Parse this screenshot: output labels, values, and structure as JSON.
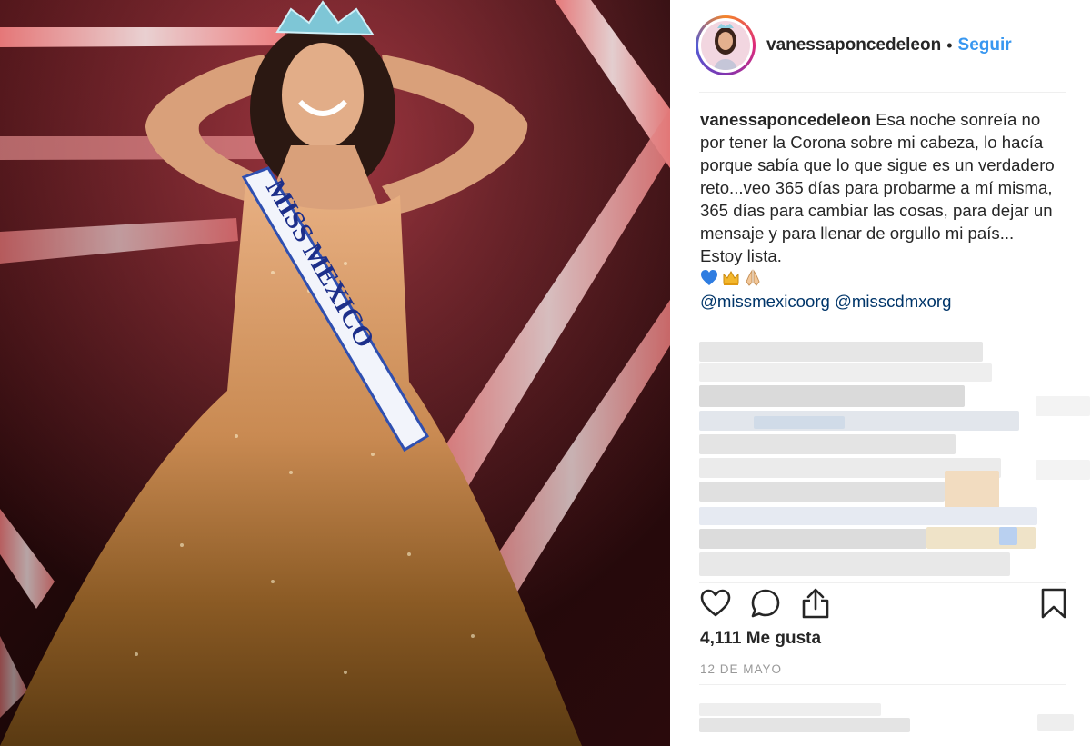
{
  "post": {
    "image_description_icon": "photo",
    "sash_text": "MISS MEXICO"
  },
  "header": {
    "username": "vanessaponcedeleon",
    "separator": "•",
    "follow_label": "Seguir"
  },
  "caption": {
    "username": "vanessaponcedeleon",
    "text": "Esa noche sonreía no por tener la Corona sobre mi cabeza, lo hacía porque sabía que lo que sigue es un verdadero reto...veo 365 días para probarme a mí misma, 365 días para cambiar las cosas, para dejar un mensaje y para llenar de orgullo mi país...",
    "closing": "Estoy lista.",
    "emojis": [
      "blue-heart-icon",
      "crown-icon",
      "praying-hands-icon"
    ],
    "mentions": [
      "@missmexicoorg",
      "@misscdmxorg"
    ]
  },
  "actions": {
    "icons": [
      "heart-icon",
      "comment-icon",
      "share-icon",
      "bookmark-icon"
    ]
  },
  "likes": {
    "label": "4,111 Me gusta"
  },
  "date": {
    "label": "12 DE MAYO"
  },
  "colors": {
    "link": "#3897f0",
    "mention": "#003569",
    "text": "#262626",
    "muted": "#999999"
  }
}
